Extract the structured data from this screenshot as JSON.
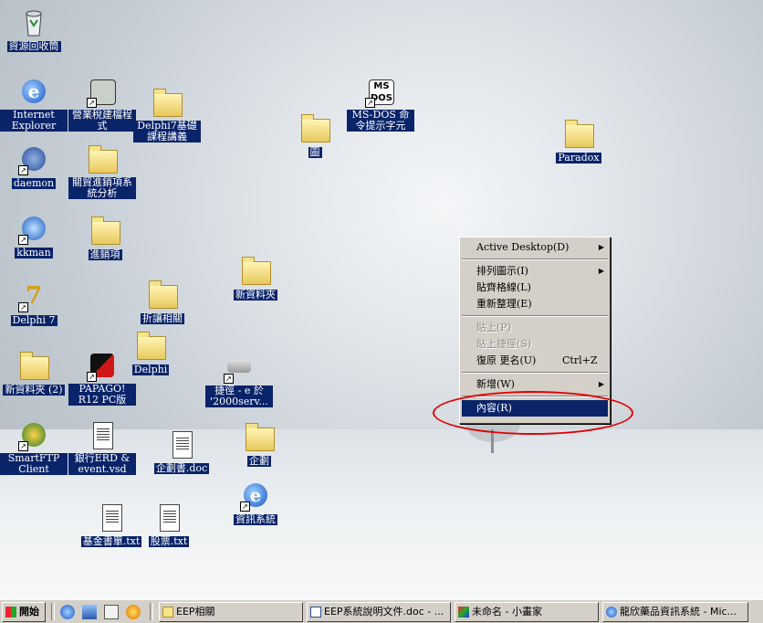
{
  "desktop_icons": [
    {
      "label": "資源回收筒",
      "icon": "recycle-bin-icon"
    },
    {
      "label": "Internet Explorer",
      "icon": "ie-icon"
    },
    {
      "label": "營業稅建檔程式",
      "icon": "calculator-app-icon"
    },
    {
      "label": "Delphi7基礎課程講義",
      "icon": "folder-icon"
    },
    {
      "label": "圖",
      "icon": "folder-icon"
    },
    {
      "label": "MS-DOS 命令提示字元",
      "icon": "msdos-icon"
    },
    {
      "label": "Paradox",
      "icon": "folder-icon"
    },
    {
      "label": "daemon",
      "icon": "daemon-tools-icon"
    },
    {
      "label": "關貿進銷項系統分析",
      "icon": "folder-icon"
    },
    {
      "label": "kkman",
      "icon": "kkman-icon"
    },
    {
      "label": "進銷項",
      "icon": "folder-icon"
    },
    {
      "label": "新資料夾",
      "icon": "folder-icon"
    },
    {
      "label": "Delphi 7",
      "icon": "delphi-icon"
    },
    {
      "label": "折讓相關",
      "icon": "folder-icon"
    },
    {
      "label": "Delphi",
      "icon": "folder-icon"
    },
    {
      "label": "新資料夾 (2)",
      "icon": "folder-icon"
    },
    {
      "label": "PAPAGO! R12 PC版",
      "icon": "papago-icon"
    },
    {
      "label": "捷徑 - e 於 '2000serv...",
      "icon": "network-drive-icon"
    },
    {
      "label": "SmartFTP Client",
      "icon": "smartftp-icon"
    },
    {
      "label": "銀行ERD & event.vsd",
      "icon": "visio-doc-icon"
    },
    {
      "label": "企劃書.doc",
      "icon": "word-doc-icon"
    },
    {
      "label": "企劃",
      "icon": "folder-icon"
    },
    {
      "label": "資訊系統",
      "icon": "ie-shortcut-icon"
    },
    {
      "label": "基金書單.txt",
      "icon": "text-file-icon"
    },
    {
      "label": "股票.txt",
      "icon": "text-file-icon"
    }
  ],
  "context_menu": {
    "items": [
      {
        "label": "Active Desktop(D)",
        "submenu": true,
        "disabled": false
      },
      {
        "label": "排列圖示(I)",
        "submenu": true,
        "disabled": false
      },
      {
        "label": "貼齊格線(L)",
        "submenu": false,
        "disabled": false
      },
      {
        "label": "重新整理(E)",
        "submenu": false,
        "disabled": false
      },
      {
        "label": "貼上(P)",
        "submenu": false,
        "disabled": true
      },
      {
        "label": "貼上捷徑(S)",
        "submenu": false,
        "disabled": true
      },
      {
        "label": "復原 更名(U)",
        "shortcut": "Ctrl+Z",
        "submenu": false,
        "disabled": false
      },
      {
        "label": "新增(W)",
        "submenu": true,
        "disabled": false
      },
      {
        "label": "內容(R)",
        "submenu": false,
        "disabled": false,
        "selected": true
      }
    ]
  },
  "taskbar": {
    "start_label": "開始",
    "quick_launch": [
      "ie-icon",
      "outlook-icon",
      "show-desktop-icon",
      "media-player-icon"
    ],
    "tasks": [
      {
        "label": "EEP相關",
        "icon": "folder-icon"
      },
      {
        "label": "EEP系統說明文件.doc - ...",
        "icon": "word-doc-icon"
      },
      {
        "label": "未命名 - 小畫家",
        "icon": "paint-icon"
      },
      {
        "label": "龍欣藥品資訊系統 - Mic...",
        "icon": "ie-icon"
      }
    ]
  },
  "colors": {
    "selection": "#0a246a",
    "annotation": "#e00000",
    "menu_bg": "#d4d0c8"
  }
}
